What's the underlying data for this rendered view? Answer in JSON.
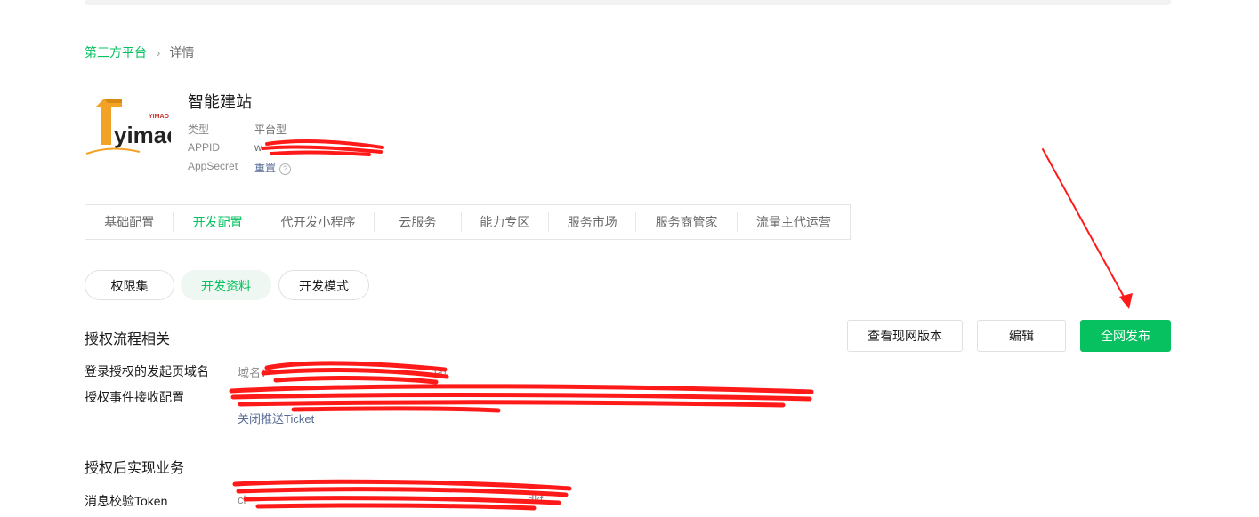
{
  "breadcrumb": {
    "parent": "第三方平台",
    "separator": "›",
    "current": "详情"
  },
  "app": {
    "name": "智能建站",
    "logo_text": "yimao",
    "logo_small_text": "YIMAO",
    "type_label": "类型",
    "type_value": "平台型",
    "appid_label": "APPID",
    "appid_value": "w",
    "secret_label": "AppSecret",
    "secret_action": "重置",
    "help_glyph": "?"
  },
  "tabs": [
    {
      "label": "基础配置"
    },
    {
      "label": "开发配置"
    },
    {
      "label": "代开发小程序"
    },
    {
      "label": "云服务"
    },
    {
      "label": "能力专区"
    },
    {
      "label": "服务市场"
    },
    {
      "label": "服务商管家"
    },
    {
      "label": "流量主代运营"
    }
  ],
  "active_tab": "开发配置",
  "subtabs": [
    {
      "label": "权限集"
    },
    {
      "label": "开发资料"
    },
    {
      "label": "开发模式"
    }
  ],
  "active_subtab": "开发资料",
  "actions": {
    "view_live": "查看现网版本",
    "edit": "编辑",
    "publish": "全网发布"
  },
  "section1": {
    "title": "授权流程相关",
    "domain_label": "登录授权的发起页域名",
    "domain_value": "域名：",
    "domain_tail": "cn",
    "event_label": "授权事件接收配置",
    "close_ticket": "关闭推送Ticket"
  },
  "section2": {
    "title": "授权后实现业务",
    "token_label": "消息校验Token",
    "token_value": "cl",
    "token_tail": "dkf"
  },
  "colors": {
    "accent": "#07c160",
    "link": "#576b95",
    "annotation": "#ff1a1a"
  }
}
